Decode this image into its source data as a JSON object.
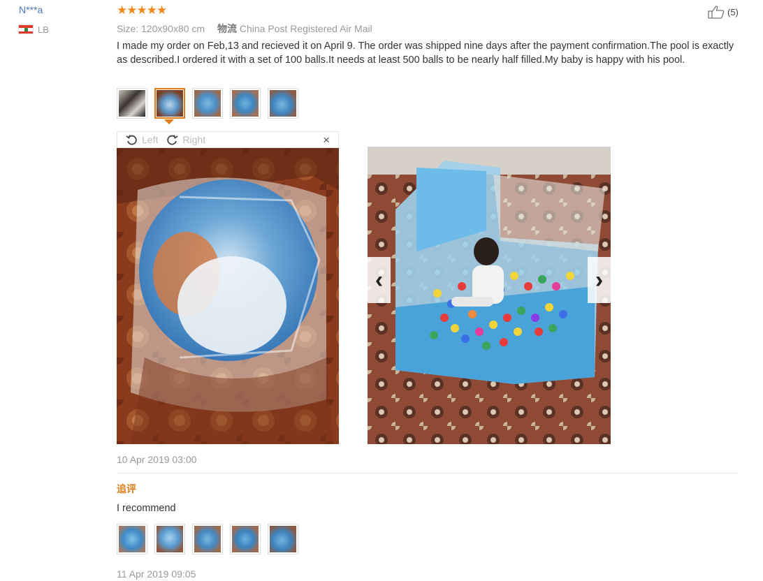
{
  "reviewer": {
    "name": "N***a",
    "country_code": "LB",
    "flag_icon": "lebanon-flag-icon"
  },
  "review": {
    "stars": "★★★★★",
    "rating": 5,
    "size_label": "Size: 120x90x80 cm",
    "shipping_label": "物流",
    "shipping_method": "China Post Registered Air Mail",
    "text": "I made my order on Feb,13 and recieved it on April 9. The order was shipped nine days after the payment confirmation.The pool is exactly as described.I ordered it with a set of 100 balls.It needs at least 500 balls to be nearly half filled.My baby is happy with his pool.",
    "helpful_count": "(5)",
    "date": "10 Apr 2019 03:00",
    "thumbnail_count": 5,
    "active_thumbnail_index": 1
  },
  "viewer": {
    "rotate_left": "Left",
    "rotate_right": "Right",
    "close": "×",
    "prev": "‹",
    "next": "›"
  },
  "additional": {
    "label": "追评",
    "text": "I recommend",
    "date": "11 Apr 2019 09:05",
    "thumbnail_count": 5
  },
  "colors": {
    "accent": "#e07b15",
    "link": "#4a78b8",
    "muted": "#999999"
  }
}
